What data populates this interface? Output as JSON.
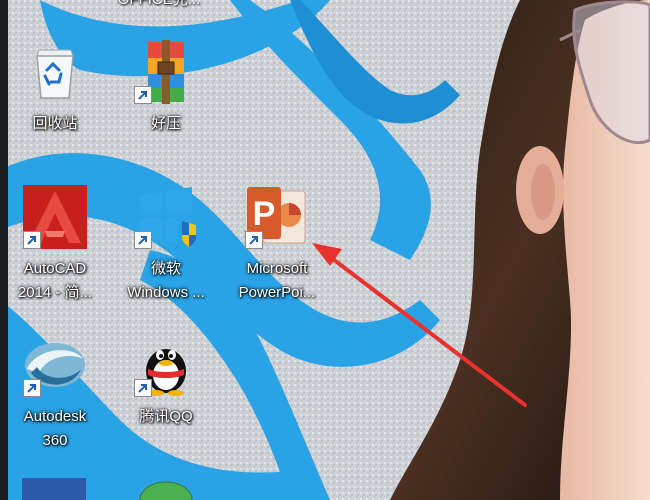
{
  "desktop": {
    "icons": [
      {
        "label_line1": "回收站",
        "label_line2": "",
        "icon": "recycle-bin-icon"
      },
      {
        "label_line1": "好压",
        "label_line2": "",
        "icon": "haozip-archive-icon"
      },
      {
        "label_line1": "AutoCAD",
        "label_line2": "2014 - 简...",
        "icon": "autocad-icon"
      },
      {
        "label_line1": "微软",
        "label_line2": "Windows ...",
        "icon": "windows-shield-icon"
      },
      {
        "label_line1": "Microsoft",
        "label_line2": "PowerPoi...",
        "icon": "powerpoint-icon"
      },
      {
        "label_line1": "Autodesk",
        "label_line2": "360",
        "icon": "autodesk-360-icon"
      },
      {
        "label_line1": "腾讯QQ",
        "label_line2": "",
        "icon": "qq-penguin-icon"
      }
    ],
    "top_cut_label": "OFFICE完...",
    "annotation": "red-arrow-pointing-to-powerpoint"
  },
  "colors": {
    "arrow": "#e8322d",
    "wallpaper_blue": "#2aa3e6",
    "wallpaper_stone": "#cfd3d8"
  }
}
